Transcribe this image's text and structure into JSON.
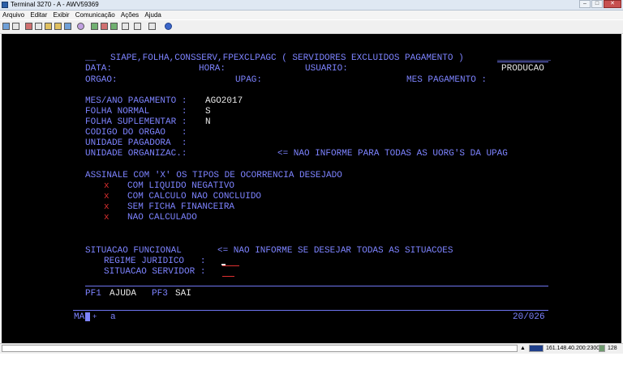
{
  "window": {
    "title": "Terminal 3270 - A - AWV59369",
    "controls": [
      "–",
      "□",
      "✕"
    ]
  },
  "menu": [
    "Arquivo",
    "Editar",
    "Exibir",
    "Comunicação",
    "Ações",
    "Ajuda"
  ],
  "toolbar_icons": [
    "print-icon",
    "print-screen-icon",
    "cut-icon",
    "copy-icon",
    "paste-icon",
    "paste-next-icon",
    "select-all-icon",
    "macro-icon",
    "record-icon",
    "stop-icon",
    "play-icon",
    "keypad-icon",
    "settings-icon",
    "transfer-icon",
    "help-icon"
  ],
  "screen": {
    "header_prefix": "__",
    "header_title": "SIAPE,FOLHA,CONSSERV,FPEXCLPAGC ( SERVIDORES EXCLUIDOS PAGAMENTO )",
    "header_suffix": "__________",
    "data_label": "DATA:",
    "hora_label": "HORA:",
    "usuario_label": "USUARIO:",
    "producao": "PRODUCAO",
    "orgao_label": "ORGAO:",
    "upag_label": "UPAG:",
    "mes_pagamento_label": "MES PAGAMENTO :",
    "mes_ano_label": "MES/ANO PAGAMENTO :",
    "mes_ano_value": "AGO2017",
    "folha_normal_label": "FOLHA NORMAL      :",
    "folha_normal_value": "S",
    "folha_suplementar_label": "FOLHA SUPLEMENTAR :",
    "folha_suplementar_value": "N",
    "codigo_orgao_label": "CODIGO DO ORGAO   :",
    "unidade_pagadora_label": "UNIDADE PAGADORA  :",
    "unidade_organizac_label": "UNIDADE ORGANIZAC.:",
    "unidade_organizac_hint": "<= NAO INFORME PARA TODAS AS UORG'S DA UPAG",
    "assinale": "ASSINALE COM 'X' OS TIPOS DE OCORRENCIA DESEJADO",
    "occurrences": [
      {
        "mark": "x",
        "label": "COM LIQUIDO NEGATIVO"
      },
      {
        "mark": "x",
        "label": "COM CALCULO NAO CONCLUIDO"
      },
      {
        "mark": "x",
        "label": "SEM FICHA FINANCEIRA"
      },
      {
        "mark": "x",
        "label": "NAO CALCULADO"
      }
    ],
    "situacao_label": "SITUACAO FUNCIONAL",
    "situacao_hint": "<= NAO INFORME SE DESEJAR TODAS AS SITUACOES",
    "regime_label": "REGIME JURIDICO   :",
    "situacao_servidor_label": "SITUACAO SERVIDOR :",
    "pf1_key": "PF1",
    "pf1_label": "AJUDA",
    "pf3_key": "PF3",
    "pf3_label": "SAI",
    "oia_left": "MA",
    "oia_plus": "+",
    "oia_a": "a",
    "cursor_pos": "20/026"
  },
  "statusbar": {
    "address": "161.148.40.200:23000",
    "number": "128"
  }
}
